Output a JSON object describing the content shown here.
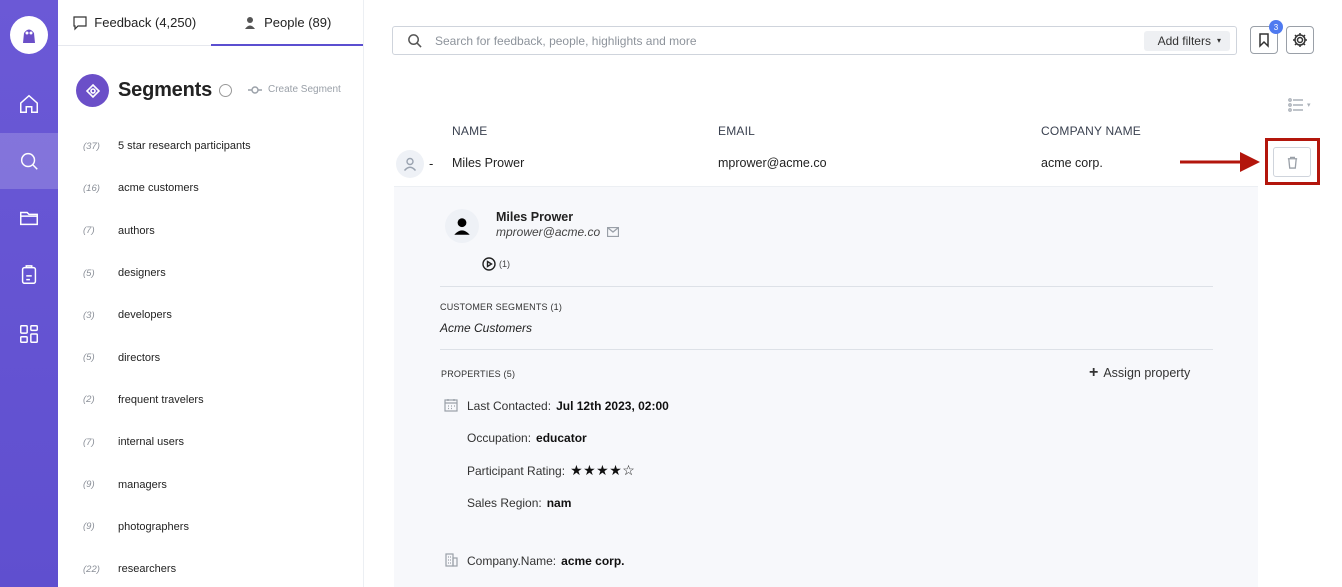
{
  "nav": {
    "items": [
      "home",
      "search",
      "folder",
      "notes",
      "dashboard"
    ],
    "active": "search"
  },
  "panel": {
    "tabs": [
      {
        "label": "Feedback (4,250)"
      },
      {
        "label": "People (89)"
      }
    ],
    "title": "Segments",
    "create_label": "Create Segment",
    "segments": [
      {
        "count": "(37)",
        "name": "5 star research participants"
      },
      {
        "count": "(16)",
        "name": "acme customers"
      },
      {
        "count": "(7)",
        "name": "authors"
      },
      {
        "count": "(5)",
        "name": "designers"
      },
      {
        "count": "(3)",
        "name": "developers"
      },
      {
        "count": "(5)",
        "name": "directors"
      },
      {
        "count": "(2)",
        "name": "frequent travelers"
      },
      {
        "count": "(7)",
        "name": "internal users"
      },
      {
        "count": "(9)",
        "name": "managers"
      },
      {
        "count": "(9)",
        "name": "photographers"
      },
      {
        "count": "(22)",
        "name": "researchers"
      }
    ]
  },
  "search": {
    "placeholder": "Search for feedback, people, highlights and more",
    "add_filters": "Add filters"
  },
  "toolbar": {
    "bookmark_badge": "3"
  },
  "table": {
    "headers": {
      "name": "NAME",
      "email": "EMAIL",
      "company": "COMPANY NAME"
    },
    "row": {
      "dash": "-",
      "name": "Miles Prower",
      "email": "mprower@acme.co",
      "company": "acme corp."
    }
  },
  "detail": {
    "name": "Miles Prower",
    "email": "mprower@acme.co",
    "recordings": "(1)",
    "segments_label": "CUSTOMER SEGMENTS (1)",
    "segment_value": "Acme Customers",
    "properties_label": "PROPERTIES (5)",
    "assign_label": "Assign property",
    "properties": [
      {
        "label": "Last Contacted:",
        "value": "Jul 12th 2023, 02:00"
      },
      {
        "label": "Occupation:",
        "value": "educator"
      },
      {
        "label": "Participant Rating:",
        "value": "★★★★☆"
      },
      {
        "label": "Sales Region:",
        "value": "nam"
      }
    ],
    "company_label": "Company.Name:",
    "company_value": "acme corp."
  },
  "colors": {
    "rail": "#6b59d6",
    "accent": "#5b4fd0",
    "highlight": "#b3160c"
  }
}
